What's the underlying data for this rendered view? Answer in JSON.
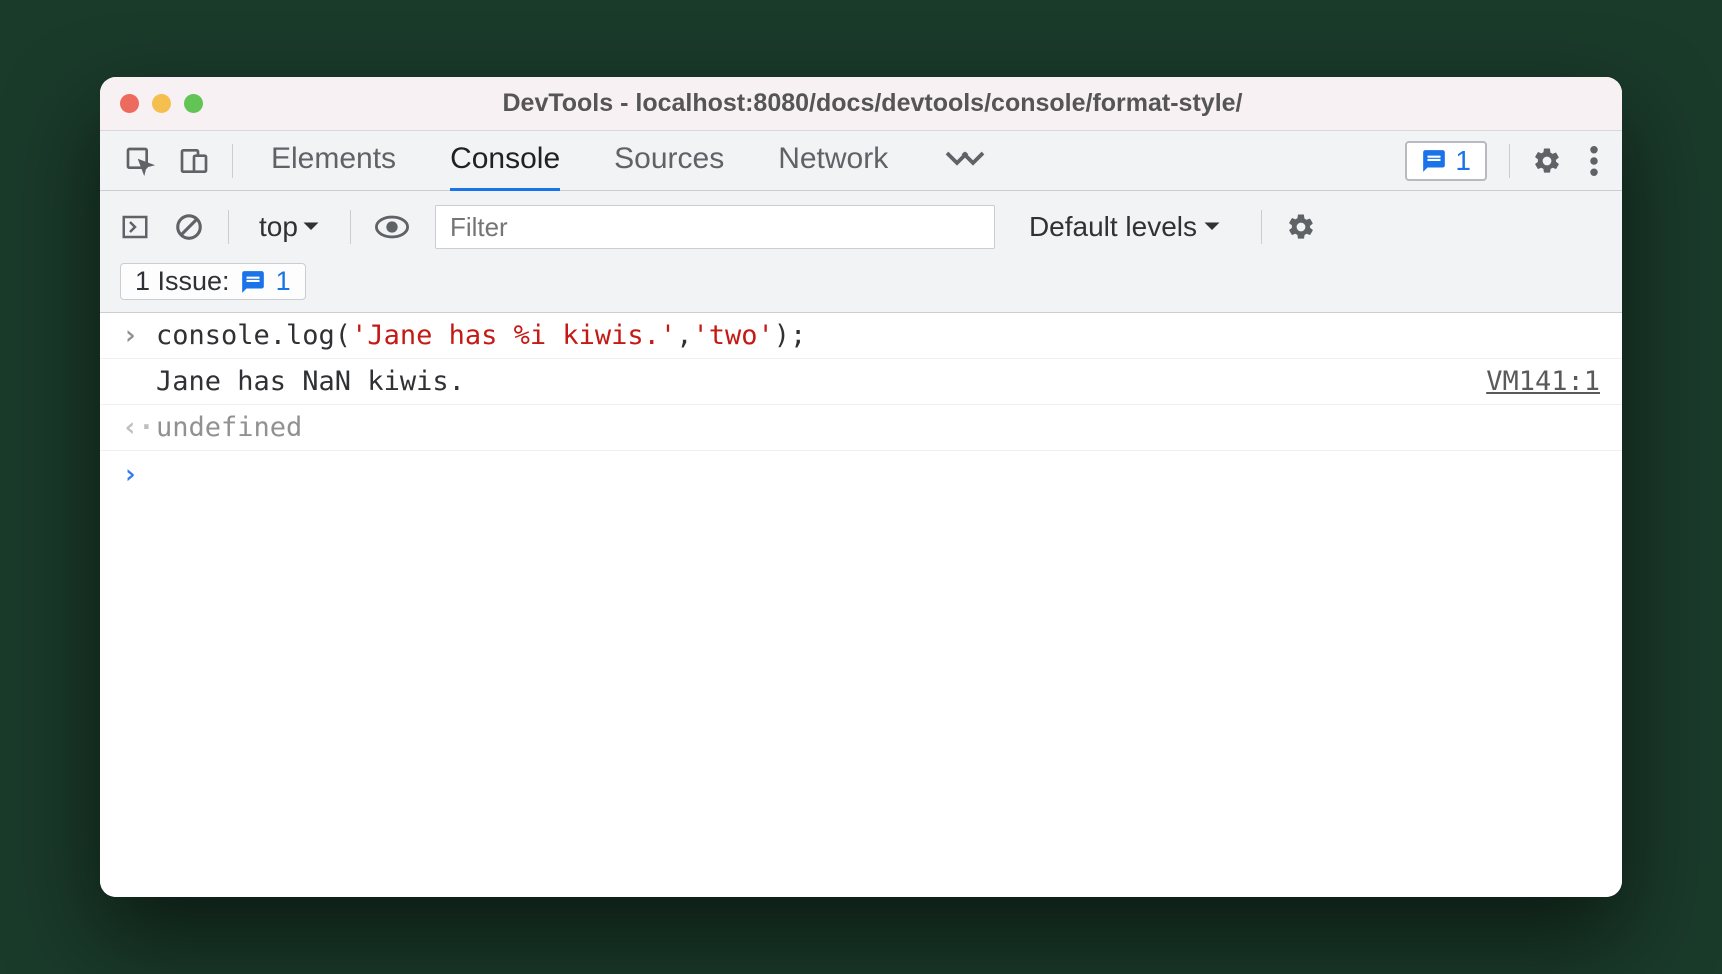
{
  "window": {
    "title": "DevTools - localhost:8080/docs/devtools/console/format-style/"
  },
  "tabs": {
    "elements": "Elements",
    "console": "Console",
    "sources": "Sources",
    "network": "Network"
  },
  "issues_badge": "1",
  "toolbar": {
    "context": "top",
    "filter_placeholder": "Filter",
    "levels": "Default levels"
  },
  "issue_pill": {
    "label": "1 Issue:",
    "count": "1"
  },
  "console": {
    "input": {
      "p1": "console.log(",
      "s1": "'Jane has %i kiwis.'",
      "p2": ", ",
      "s2": "'two'",
      "p3": ");"
    },
    "output": "Jane has NaN kiwis.",
    "source": "VM141:1",
    "result": "undefined"
  }
}
